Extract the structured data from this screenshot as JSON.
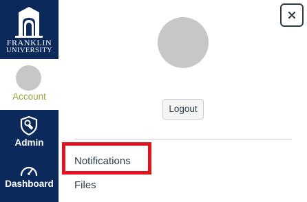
{
  "brand": {
    "line1": "FRANKLIN",
    "line2": "UNIVERSITY",
    "color": "#0b2a5b",
    "logo_icon": "franklin-arch-icon"
  },
  "nav": {
    "account": {
      "label": "Account",
      "label_color": "#9aa33b"
    },
    "admin": {
      "label": "Admin",
      "icon": "wrench-shield-icon"
    },
    "dashboard": {
      "label": "Dashboard",
      "icon": "speedometer-icon"
    }
  },
  "tray": {
    "close_icon": "close-icon",
    "logout_label": "Logout",
    "links": [
      {
        "label": "Notifications",
        "highlighted": true
      },
      {
        "label": "Files",
        "highlighted": false
      }
    ],
    "highlight_color": "#e0141e"
  }
}
